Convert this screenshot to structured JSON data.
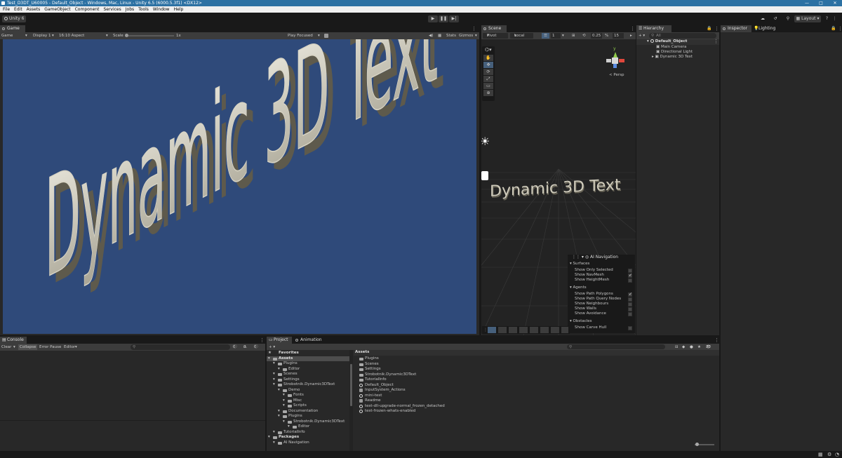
{
  "window": {
    "title": "Test_D3DT_U60005 - Default_Object - Windows, Mac, Linux - Unity 6.5 (6000.5.3f1) <DX12>"
  },
  "menu": [
    "File",
    "Edit",
    "Assets",
    "GameObject",
    "Component",
    "Services",
    "Jobs",
    "Tools",
    "Window",
    "Help"
  ],
  "toolbar": {
    "account": "Unity 6",
    "layout": "Layout"
  },
  "game": {
    "tab": "Game",
    "mode": "Game",
    "display": "Display 1",
    "aspect": "16:10 Aspect",
    "scale_label": "Scale",
    "scale_value": "1x",
    "play_focused": "Play Focused",
    "stats": "Stats",
    "gizmos": "Gizmos",
    "text": "Dynamic 3D Text",
    "bg": "#2f4a7a"
  },
  "scene": {
    "tab": "Scene",
    "pivot": "Pivot",
    "local": "Local",
    "snap": "0.25",
    "grid": "15",
    "grid_num": "1",
    "persp": "< Persp",
    "text": "Dynamic 3D Text"
  },
  "ai_nav": {
    "title": "AI Navigation",
    "sections": [
      {
        "name": "Surfaces",
        "items": [
          {
            "label": "Show Only Selected",
            "on": false
          },
          {
            "label": "Show NavMesh",
            "on": true
          },
          {
            "label": "Show HeightMesh",
            "on": false
          }
        ]
      },
      {
        "name": "Agents",
        "items": [
          {
            "label": "Show Path Polygons",
            "on": true
          },
          {
            "label": "Show Path Query Nodes",
            "on": false
          },
          {
            "label": "Show Neighbours",
            "on": false
          },
          {
            "label": "Show Walls",
            "on": false
          },
          {
            "label": "Show Avoidance",
            "on": false
          }
        ]
      },
      {
        "name": "Obstacles",
        "items": [
          {
            "label": "Show Carve Hull",
            "on": false
          }
        ]
      }
    ]
  },
  "hierarchy": {
    "tab": "Hierarchy",
    "search": "All",
    "root": "Default_Object",
    "children": [
      "Main Camera",
      "Directional Light",
      "Dynamic 3D Text"
    ]
  },
  "inspector": {
    "tab": "Inspector",
    "tab2": "Lighting"
  },
  "console": {
    "tab": "Console",
    "clear": "Clear",
    "collapse": "Collapse",
    "error_pause": "Error Pause",
    "editor": "Editor",
    "c1": "0",
    "c2": "0",
    "c3": "0"
  },
  "project": {
    "tab": "Project",
    "tab2": "Animation",
    "count": "22",
    "tree": [
      {
        "label": "Favorites",
        "indent": 0,
        "bold": true
      },
      {
        "label": "Assets",
        "indent": 0,
        "bold": true,
        "sel": true
      },
      {
        "label": "Plugins",
        "indent": 1
      },
      {
        "label": "Editor",
        "indent": 2
      },
      {
        "label": "Scenes",
        "indent": 1
      },
      {
        "label": "Settings",
        "indent": 1
      },
      {
        "label": "Strobotnik.Dynamic3DText",
        "indent": 1
      },
      {
        "label": "Demo",
        "indent": 2
      },
      {
        "label": "Fonts",
        "indent": 3
      },
      {
        "label": "Misc",
        "indent": 3
      },
      {
        "label": "Scripts",
        "indent": 3
      },
      {
        "label": "Documentation",
        "indent": 2
      },
      {
        "label": "Plugins",
        "indent": 2
      },
      {
        "label": "Strobotnik.Dynamic3DText",
        "indent": 3
      },
      {
        "label": "Editor",
        "indent": 4
      },
      {
        "label": "TutorialInfo",
        "indent": 1
      },
      {
        "label": "Packages",
        "indent": 0,
        "bold": true
      },
      {
        "label": "AI Navigation",
        "indent": 1
      }
    ],
    "breadcrumb": "Assets",
    "files": [
      {
        "label": "Plugins",
        "kind": "folder"
      },
      {
        "label": "Scenes",
        "kind": "folder"
      },
      {
        "label": "Settings",
        "kind": "folder"
      },
      {
        "label": "Strobotnik.Dynamic3DText",
        "kind": "folder"
      },
      {
        "label": "TutorialInfo",
        "kind": "folder"
      },
      {
        "label": "Default_Object",
        "kind": "unity"
      },
      {
        "label": "InputSystem_Actions",
        "kind": "asset"
      },
      {
        "label": "mini-test",
        "kind": "unity"
      },
      {
        "label": "Readme",
        "kind": "asset"
      },
      {
        "label": "test-dll-upgrade-normal_frozen_detached",
        "kind": "unity"
      },
      {
        "label": "test-frozen-whats-enabled",
        "kind": "unity"
      }
    ]
  }
}
